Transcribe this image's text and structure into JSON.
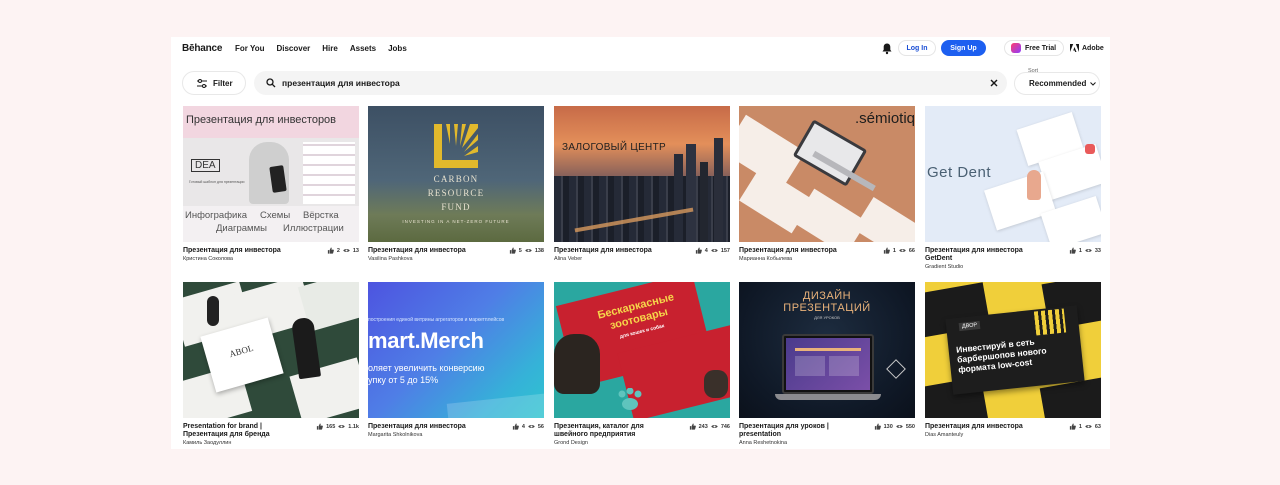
{
  "nav": {
    "logo": "Bēhance",
    "links": [
      "For You",
      "Discover",
      "Hire",
      "Assets",
      "Jobs"
    ],
    "login": "Log In",
    "signup": "Sign Up",
    "free_trial": "Free Trial",
    "adobe": "Adobe"
  },
  "filter": {
    "label": "Filter"
  },
  "search": {
    "value": "презентация для инвестора"
  },
  "sort": {
    "label": "Sort",
    "value": "Recommended"
  },
  "projects": [
    {
      "title": "Презентация для инвестора",
      "author": "Кристина Соколова",
      "likes": "2",
      "views": "13",
      "thumb": {
        "heading": "Презентация для инвесторов",
        "badge": "DEA",
        "tagline": "Готовый шаблон для презентации",
        "words": [
          "Инфографика",
          "Схемы",
          "Вёрстка",
          "Диаграммы",
          "Иллюстрации"
        ]
      }
    },
    {
      "title": "Презентация для инвестора",
      "author": "Vasilina Pashkova",
      "likes": "5",
      "views": "138",
      "thumb": {
        "lines": [
          "CARBON",
          "RESOURCE",
          "FUND"
        ],
        "tagline": "INVESTING IN A NET-ZERO FUTURE"
      }
    },
    {
      "title": "Презентация для инвестора",
      "author": "Alina Veber",
      "likes": "4",
      "views": "157",
      "thumb": {
        "heading": "ЗАЛОГОВЫЙ ЦЕНТР"
      }
    },
    {
      "title": "Презентация для инвестора",
      "author": "Марианна Кобылева",
      "likes": "1",
      "views": "66",
      "thumb": {
        "heading": ".sémiotiq"
      }
    },
    {
      "title": "Презентация для инвестора GetDent",
      "author": "Gradient Studio",
      "likes": "1",
      "views": "33",
      "thumb": {
        "heading": "Get Dent"
      }
    },
    {
      "title": "Presentation for brand | Презентация для бренда",
      "author": "Камиль Заодуллин",
      "likes": "165",
      "views": "1.1k",
      "thumb": {
        "heading": "ABOL"
      }
    },
    {
      "title": "Презентация для инвестора",
      "author": "Margarita Shkolnikova",
      "likes": "4",
      "views": "56",
      "thumb": {
        "small": "построения единой витрины агрегаторов и маркетплейсов",
        "heading": "mart.Merch",
        "lines": [
          "оляет увеличить конверсию",
          "упку от 5 до 15%"
        ]
      }
    },
    {
      "title": "Презентация, каталог для швейного предприятия",
      "author": "Grond Design",
      "likes": "243",
      "views": "746",
      "thumb": {
        "lines": [
          "Бескаркасные",
          "зоотовары",
          "для кошек и собак"
        ]
      }
    },
    {
      "title": "Презентация для уроков | presentation",
      "author": "Anna Reshetnokina",
      "likes": "130",
      "views": "550",
      "thumb": {
        "lines": [
          "ДИЗАЙН",
          "ПРЕЗЕНТАЦИЙ"
        ],
        "small": "ДЛЯ УРОКОВ"
      }
    },
    {
      "title": "Презентация для инвестора",
      "author": "Dias Amanteuly",
      "likes": "1",
      "views": "63",
      "thumb": {
        "badge": "ДВОР",
        "lines": [
          "Инвестируй в сеть",
          "барбершопов нового",
          "формата low-cost"
        ]
      }
    }
  ]
}
